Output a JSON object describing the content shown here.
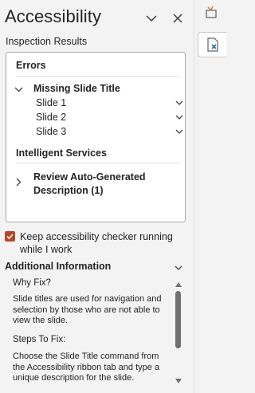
{
  "pane": {
    "title": "Accessibility",
    "subtitle": "Inspection Results"
  },
  "results": {
    "errors_heading": "Errors",
    "missing_title_label": "Missing Slide Title",
    "slides": [
      "Slide 1",
      "Slide 2",
      "Slide 3"
    ],
    "intelligent_heading": "Intelligent Services",
    "review_label_line1": "Review Auto-Generated",
    "review_label_line2": "Description (1)"
  },
  "keep_running": {
    "label": "Keep accessibility checker running while I work",
    "checked": true
  },
  "additional": {
    "heading": "Additional Information",
    "why_heading": "Why Fix?",
    "why_text": "Slide titles are used for navigation and selection by those who are not able to view the slide.",
    "steps_heading": "Steps To Fix:",
    "steps_text": "Choose the Slide Title command from the Accessibility ribbon tab and type a unique description for the slide."
  },
  "colors": {
    "accent": "#b7472a",
    "rail_icon": "#2b6cb0"
  },
  "icons": {
    "collapse": "chevron-down-icon",
    "close": "close-icon",
    "rail_top": "format-painter-icon",
    "rail_active": "accessibility-checker-icon"
  }
}
